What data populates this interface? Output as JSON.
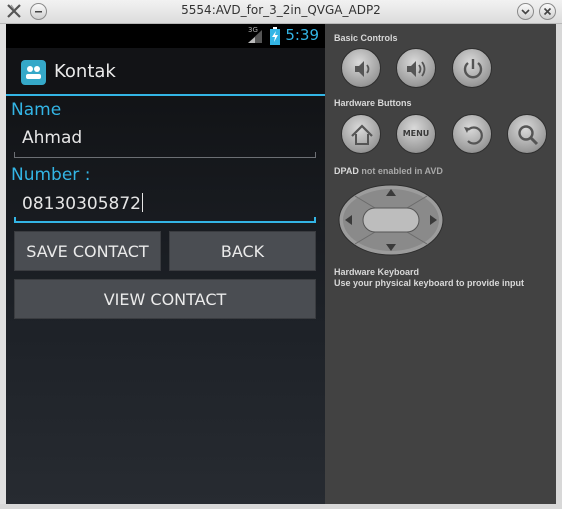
{
  "window": {
    "title": "5554:AVD_for_3_2in_QVGA_ADP2"
  },
  "statusbar": {
    "network": "3G",
    "clock": "5:39"
  },
  "app": {
    "title": "Kontak",
    "name_label": "Name",
    "name_value": "Ahmad",
    "number_label": "Number :",
    "number_value": "08130305872",
    "save_label": "SAVE CONTACT",
    "back_label": "BACK",
    "view_label": "VIEW CONTACT"
  },
  "controls": {
    "basic_title": "Basic Controls",
    "hardware_title": "Hardware Buttons",
    "menu_label": "MENU",
    "dpad_title": "DPAD",
    "dpad_note": "not enabled in AVD",
    "keyboard_title": "Hardware Keyboard",
    "keyboard_note": "Use your physical keyboard to provide input"
  },
  "colors": {
    "accent": "#33b5e5",
    "panel": "#424242"
  }
}
